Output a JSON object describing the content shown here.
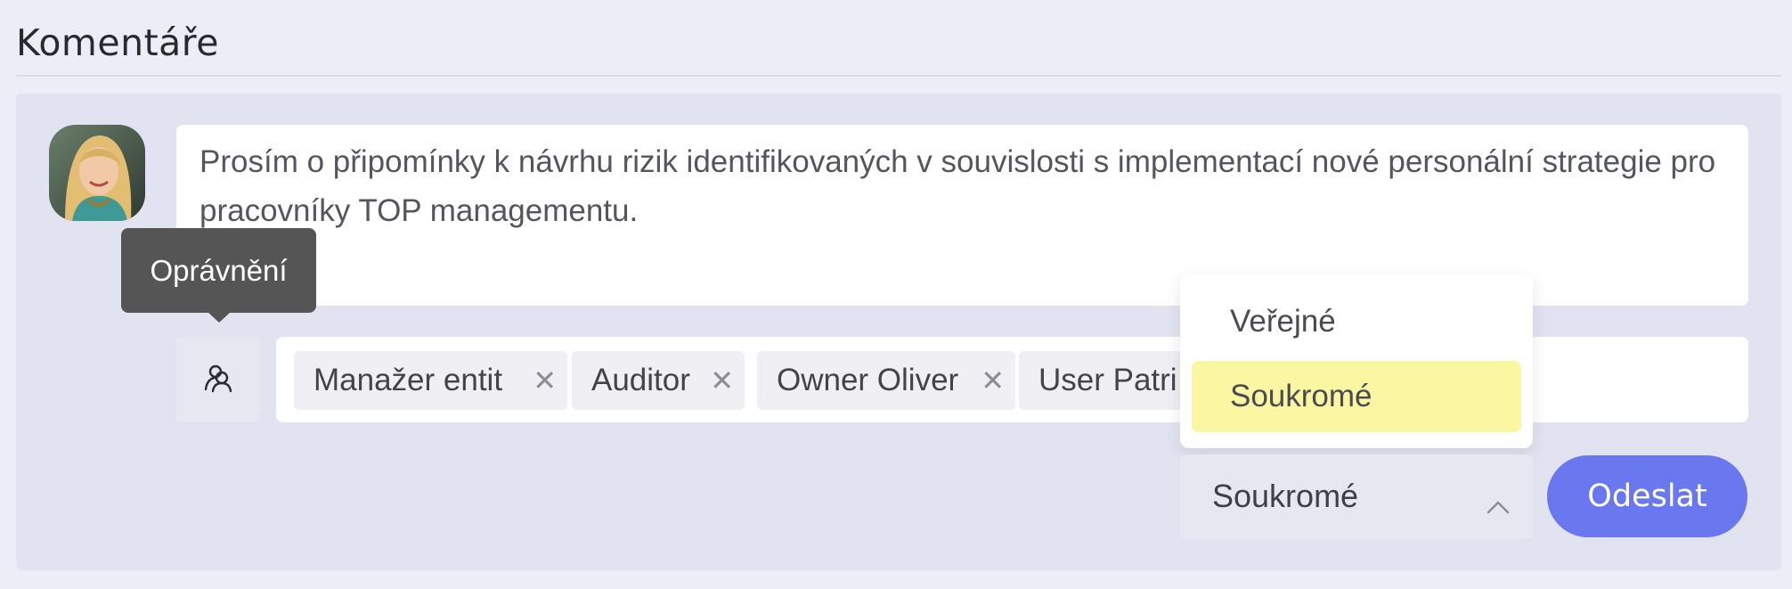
{
  "section": {
    "title": "Komentáře"
  },
  "comment": {
    "text": "Prosím o připomínky k návrhu rizik identifikovaných v souvislosti s implementací nové personální strategie pro pracovníky TOP managementu."
  },
  "tooltip": {
    "label": "Oprávnění"
  },
  "permissions": {
    "icon": "users-icon",
    "tags": [
      "Manažer entit",
      "Auditor",
      "Owner Oliver",
      "User Patri"
    ]
  },
  "visibility": {
    "options": [
      "Veřejné",
      "Soukromé"
    ],
    "selected": "Soukromé"
  },
  "actions": {
    "send_label": "Odeslat"
  },
  "colors": {
    "accent": "#6a78ef",
    "selected_highlight": "#fbf6a1",
    "tooltip_bg": "#555555"
  }
}
